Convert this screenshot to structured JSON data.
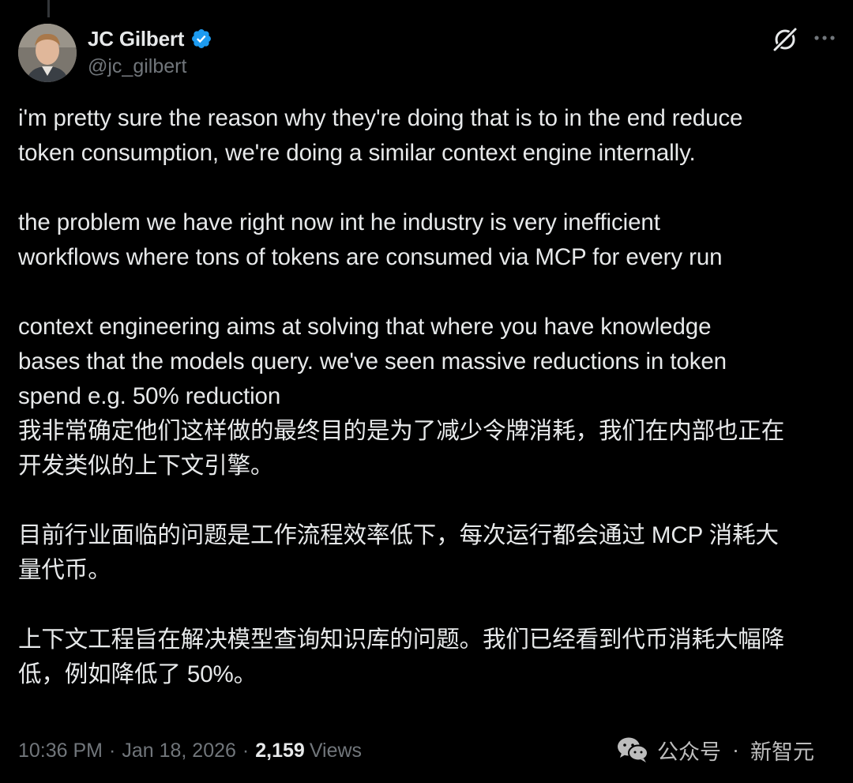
{
  "author": {
    "name": "JC Gilbert",
    "handle": "@jc_gilbert",
    "verified": true,
    "verified_color": "#1d9bf0"
  },
  "tweet": {
    "paragraphs_en": [
      "i'm pretty sure the reason why they're doing that is to in the end reduce\ntoken consumption, we're doing a similar context engine internally.",
      "the problem we have right now int he industry is very inefficient\nworkflows where tons of tokens are consumed via MCP for every run",
      "context engineering aims at solving that where you have knowledge\nbases that the models query. we've seen massive reductions in token\nspend e.g. 50% reduction"
    ],
    "paragraphs_zh": [
      "我非常确定他们这样做的最终目的是为了减少令牌消耗，我们在内部也正在\n开发类似的上下文引擎。",
      "目前行业面临的问题是工作流程效率低下，每次运行都会通过 MCP 消耗大\n量代币。",
      "上下文工程旨在解决模型查询知识库的问题。我们已经看到代币消耗大幅降\n低，例如降低了 50%。"
    ]
  },
  "meta": {
    "time": "10:36 PM",
    "date": "Jan 18, 2026",
    "separator": "·",
    "views_count": "2,159",
    "views_label": "Views"
  },
  "watermark": {
    "text": "公众号",
    "dot": "·",
    "source": "新智元"
  },
  "icons": {
    "verified": "verified-badge-icon",
    "grok": "grok-icon",
    "more": "more-options-icon",
    "wechat": "wechat-icon"
  },
  "colors": {
    "background": "#000000",
    "text": "#e7e9ea",
    "secondary": "#71767b",
    "accent": "#1d9bf0"
  }
}
